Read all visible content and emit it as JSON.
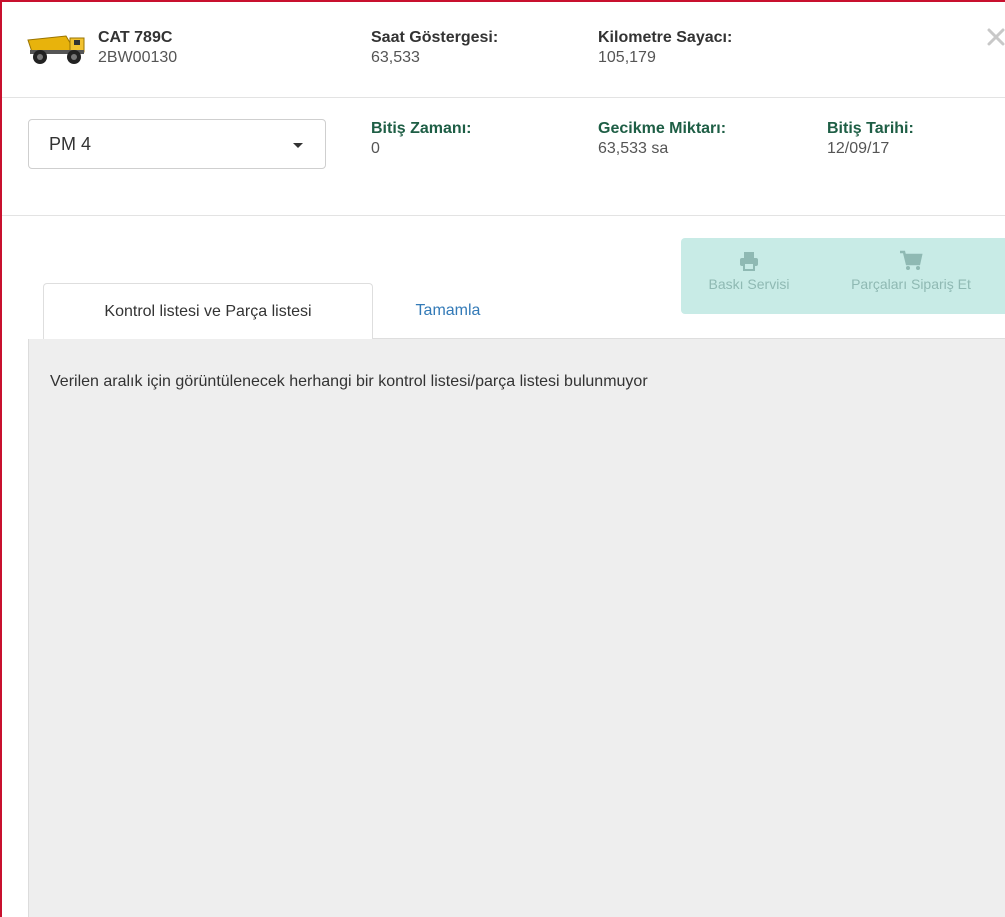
{
  "header": {
    "model": "CAT 789C",
    "serial": "2BW00130",
    "hour_meter_label": "Saat Göstergesi:",
    "hour_meter_value": "63,533",
    "odometer_label": "Kilometre Sayacı:",
    "odometer_value": "105,179"
  },
  "interval": {
    "selected": "PM 4",
    "end_time_label": "Bitiş Zamanı:",
    "end_time_value": "0",
    "delay_label": "Gecikme Miktarı:",
    "delay_value": "63,533 sa",
    "end_date_label": "Bitiş Tarihi:",
    "end_date_value": "12/09/17"
  },
  "actions": {
    "print_label": "Baskı Servisi",
    "order_parts_label": "Parçaları Sipariş Et"
  },
  "tabs": [
    {
      "label": "Kontrol listesi ve Parça listesi",
      "active": true
    },
    {
      "label": "Tamamla",
      "active": false
    }
  ],
  "panel": {
    "message": "Verilen aralık için görüntülenecek herhangi bir kontrol listesi/parça listesi bulunmuyor"
  },
  "colors": {
    "accent_green": "#1e5e45",
    "action_bar_bg": "#c8ebe6",
    "link_blue": "#337ab7",
    "frame_red": "#c8102e"
  }
}
